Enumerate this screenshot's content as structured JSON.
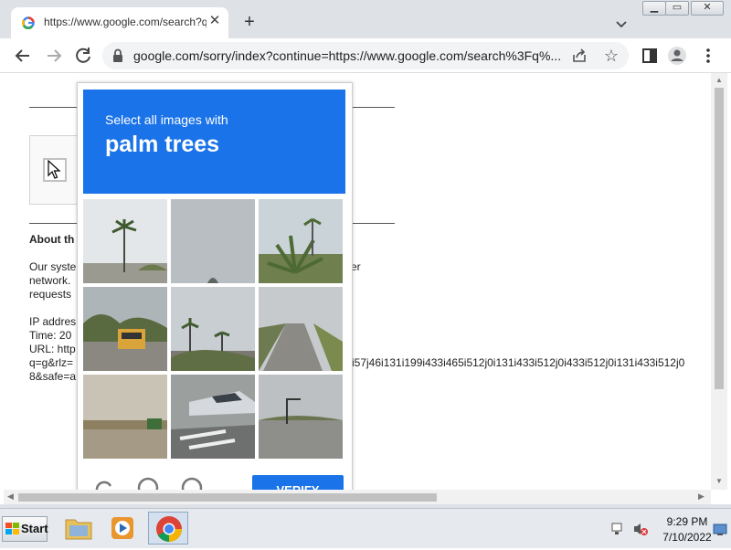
{
  "tab": {
    "title": "https://www.google.com/search?q="
  },
  "address_bar": {
    "url": "google.com/sorry/index?continue=https://www.google.com/search%3Fq%..."
  },
  "page": {
    "about_heading": "About th",
    "para_lines": [
      "Our syste",
      "network.",
      "requests"
    ],
    "para_right": "er",
    "ip_label": "IP addres",
    "time_label": "Time: 20",
    "url_label": "URL: http",
    "url_line2": "q=g&rlz=",
    "url_line2_right": "i57j46i131i199i433i465i512j0i131i433i512j0i433i512j0i131i433i512j0",
    "url_line3": "8&safe=a"
  },
  "captcha": {
    "instruction": "Select all images with",
    "object": "palm trees",
    "verify_label": "VERIFY"
  },
  "taskbar": {
    "start_label": "Start",
    "clock_time": "9:29 PM",
    "clock_date": "7/10/2022"
  },
  "colors": {
    "accent": "#1a73e8"
  }
}
